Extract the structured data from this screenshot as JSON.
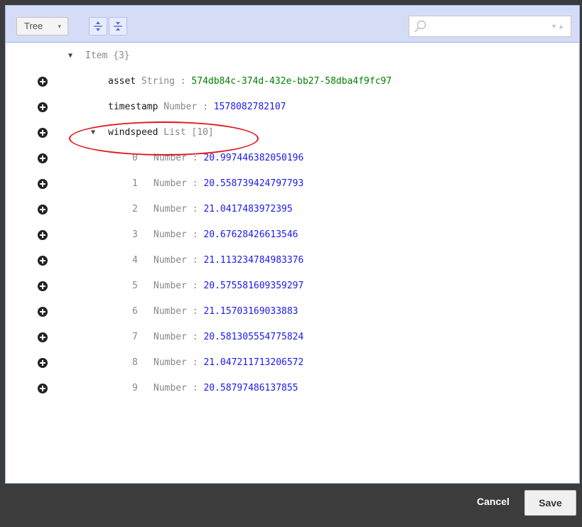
{
  "toolbar": {
    "mode_label": "Tree",
    "mode_caret": "▾",
    "expand_all_icon": "expand-all-icon",
    "collapse_all_icon": "collapse-all-icon",
    "search_placeholder": "",
    "search_nav": "▼▲"
  },
  "tree": {
    "root": {
      "label": "Item",
      "count": "{3}"
    },
    "fields": [
      {
        "name": "asset",
        "type": "String",
        "value": "574db84c-374d-432e-bb27-58dba4f9fc97"
      },
      {
        "name": "timestamp",
        "type": "Number",
        "value": "1578082782107"
      },
      {
        "name": "windspeed",
        "type": "List",
        "count": "[10]"
      }
    ],
    "list_items": [
      {
        "index": "0",
        "type": "Number",
        "value": "20.997446382050196"
      },
      {
        "index": "1",
        "type": "Number",
        "value": "20.558739424797793"
      },
      {
        "index": "2",
        "type": "Number",
        "value": "21.0417483972395"
      },
      {
        "index": "3",
        "type": "Number",
        "value": "20.67628426613546"
      },
      {
        "index": "4",
        "type": "Number",
        "value": "21.113234784983376"
      },
      {
        "index": "5",
        "type": "Number",
        "value": "20.575581609359297"
      },
      {
        "index": "6",
        "type": "Number",
        "value": "21.15703169033883"
      },
      {
        "index": "7",
        "type": "Number",
        "value": "20.581305554775824"
      },
      {
        "index": "8",
        "type": "Number",
        "value": "21.047211713206572"
      },
      {
        "index": "9",
        "type": "Number",
        "value": "20.58797486137855"
      }
    ],
    "separator": ":"
  },
  "footer": {
    "cancel_label": "Cancel",
    "save_label": "Save"
  },
  "colors": {
    "toolbar_bg": "#d5ddf6",
    "string_value": "#008000",
    "number_value": "#1a1aee",
    "highlight_ring": "#e0161b",
    "footer_bg": "#3c3c3c"
  }
}
